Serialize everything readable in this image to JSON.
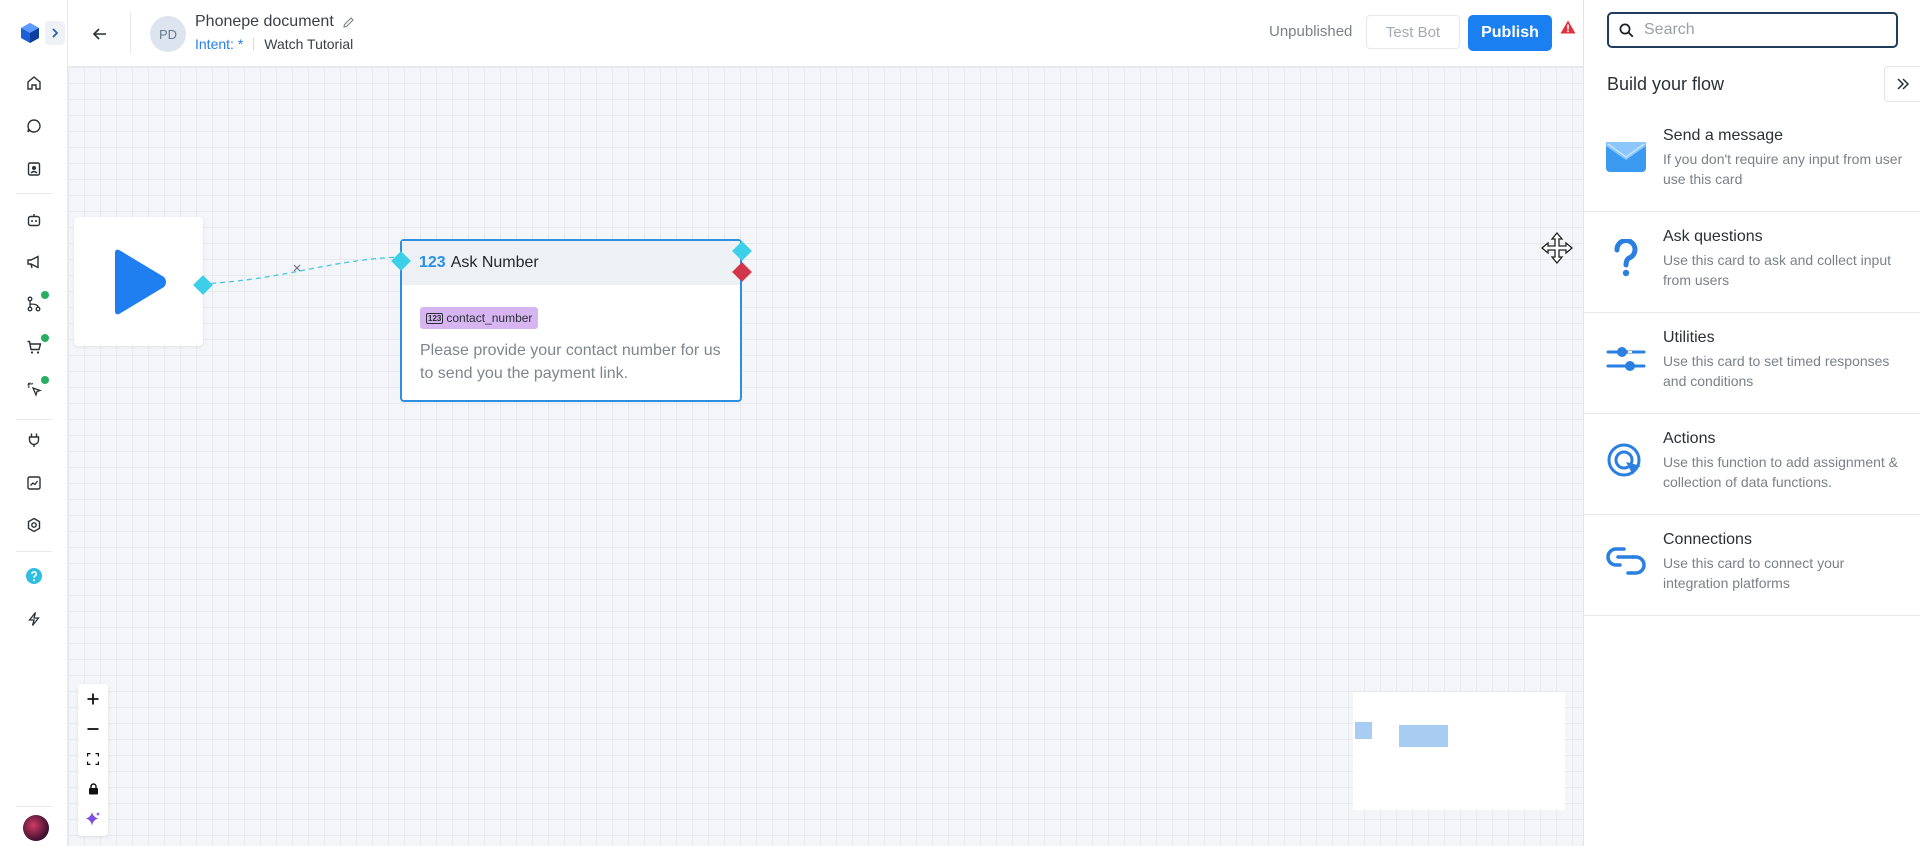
{
  "header": {
    "avatar_initials": "PD",
    "doc_title": "Phonepe document",
    "intent_label": "Intent: *",
    "watch_tutorial": "Watch Tutorial",
    "status": "Unpublished",
    "test_bot": "Test Bot",
    "publish": "Publish"
  },
  "canvas": {
    "ask_node": {
      "icon_text": "123",
      "title": "Ask Number",
      "variable_badge": "123",
      "variable": "contact_number",
      "message": "Please provide your contact number for us to send you the payment link."
    },
    "zoom_controls": {
      "zoom_in": "+",
      "zoom_out": "−"
    }
  },
  "panel": {
    "search_placeholder": "Search",
    "title": "Build your flow",
    "cards": [
      {
        "title": "Send a message",
        "desc": "If you don't require any input from user use this card",
        "icon": "envelope-icon"
      },
      {
        "title": "Ask questions",
        "desc": "Use this card to ask and collect input from users",
        "icon": "question-icon"
      },
      {
        "title": "Utilities",
        "desc": "Use this card to set timed responses and conditions",
        "icon": "sliders-icon"
      },
      {
        "title": "Actions",
        "desc": "Use this function to add assignment & collection of data functions.",
        "icon": "target-icon"
      },
      {
        "title": "Connections",
        "desc": "Use this card to connect your integration platforms",
        "icon": "link-icon"
      }
    ]
  },
  "sidebar": {
    "items": [
      "home-icon",
      "chat-icon",
      "contacts-icon",
      "bot-icon",
      "broadcast-icon",
      "flow-icon",
      "cart-icon",
      "click-icon",
      "plug-icon",
      "analytics-icon",
      "settings-icon",
      "help-icon",
      "bolt-icon"
    ]
  },
  "colors": {
    "accent": "#1a7ff0",
    "node_border": "#2b8fe4",
    "handle_cyan": "#3ccfe8",
    "handle_red": "#d1364a",
    "variable_tag": "#d7b5f1"
  }
}
